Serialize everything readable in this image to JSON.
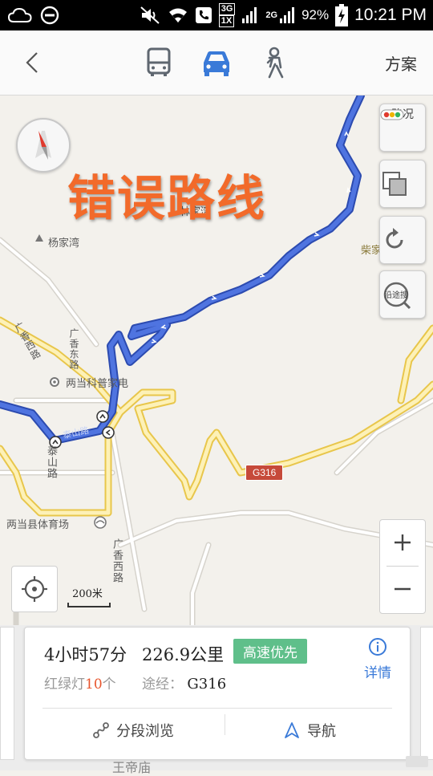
{
  "status_bar": {
    "network_3g": "3G",
    "network_1x": "1X",
    "network_2g": "2G",
    "battery": "92%",
    "time": "10:21 PM"
  },
  "top_bar": {
    "modes": [
      "bus-icon",
      "car-icon",
      "walk-icon"
    ],
    "active_mode": "car",
    "plan_label": "方案",
    "accent_color": "#3a7ad8"
  },
  "map": {
    "overlay_title": "错误路线",
    "places": {
      "linjiawan": "林家湾",
      "yangjiawan": "杨家湾",
      "chaijiayao": "柴家窑",
      "liangdang_shop": "两当科普家电",
      "stadium": "两当县体育场",
      "guangxiang_east": "广香东路",
      "guangxiang_west_top": "广香西路",
      "guangxiang_west_bottom": "广香西路",
      "taishan": "泰山路",
      "taishan_route": "泰山路"
    },
    "highway": "G316",
    "controls": {
      "traffic_label": "路况",
      "along_label": "沿途搜"
    },
    "scale_label": "200米",
    "route_color": "#4468d8"
  },
  "route_card": {
    "duration": "4小时57分",
    "distance": "226.9公里",
    "preference": "高速优先",
    "lights_prefix": "红绿灯",
    "lights_count": "10",
    "lights_suffix": "个",
    "via_label": "途经：",
    "via_road": "G316",
    "detail_label": "详情",
    "segment_label": "分段浏览",
    "navigate_label": "导航",
    "peek_text": "王帝庙"
  }
}
